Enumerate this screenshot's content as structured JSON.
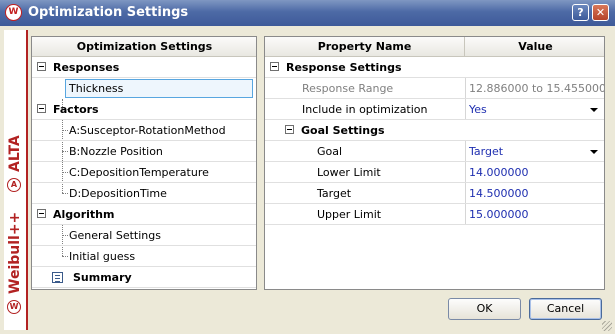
{
  "window": {
    "title": "Optimization Settings",
    "help_button": "?",
    "close_button": "✕"
  },
  "branding": {
    "product1": "ALTA",
    "product2": "Weibull++",
    "logo_letter": "W",
    "alta_letter": "A",
    "accent_color": "#b22222"
  },
  "left_panel": {
    "header": "Optimization Settings",
    "groups": [
      {
        "label": "Responses",
        "items": [
          "Thickness"
        ]
      },
      {
        "label": "Factors",
        "items": [
          "A:Susceptor-RotationMethod",
          "B:Nozzle Position",
          "C:DepositionTemperature",
          "D:DepositionTime"
        ]
      },
      {
        "label": "Algorithm",
        "items": [
          "General Settings",
          "Initial guess"
        ]
      }
    ],
    "summary": "Summary",
    "selected_item": "Thickness"
  },
  "right_panel": {
    "col_property": "Property Name",
    "col_value": "Value",
    "section1": "Response Settings",
    "response_range_label": "Response Range",
    "response_range_value": "12.886000 to 15.455000",
    "include_label": "Include in optimization",
    "include_value": "Yes",
    "section2": "Goal Settings",
    "goal_label": "Goal",
    "goal_value": "Target",
    "lower_label": "Lower Limit",
    "lower_value": "14.000000",
    "target_label": "Target",
    "target_value": "14.500000",
    "upper_label": "Upper Limit",
    "upper_value": "15.000000"
  },
  "buttons": {
    "ok": "OK",
    "cancel": "Cancel"
  }
}
